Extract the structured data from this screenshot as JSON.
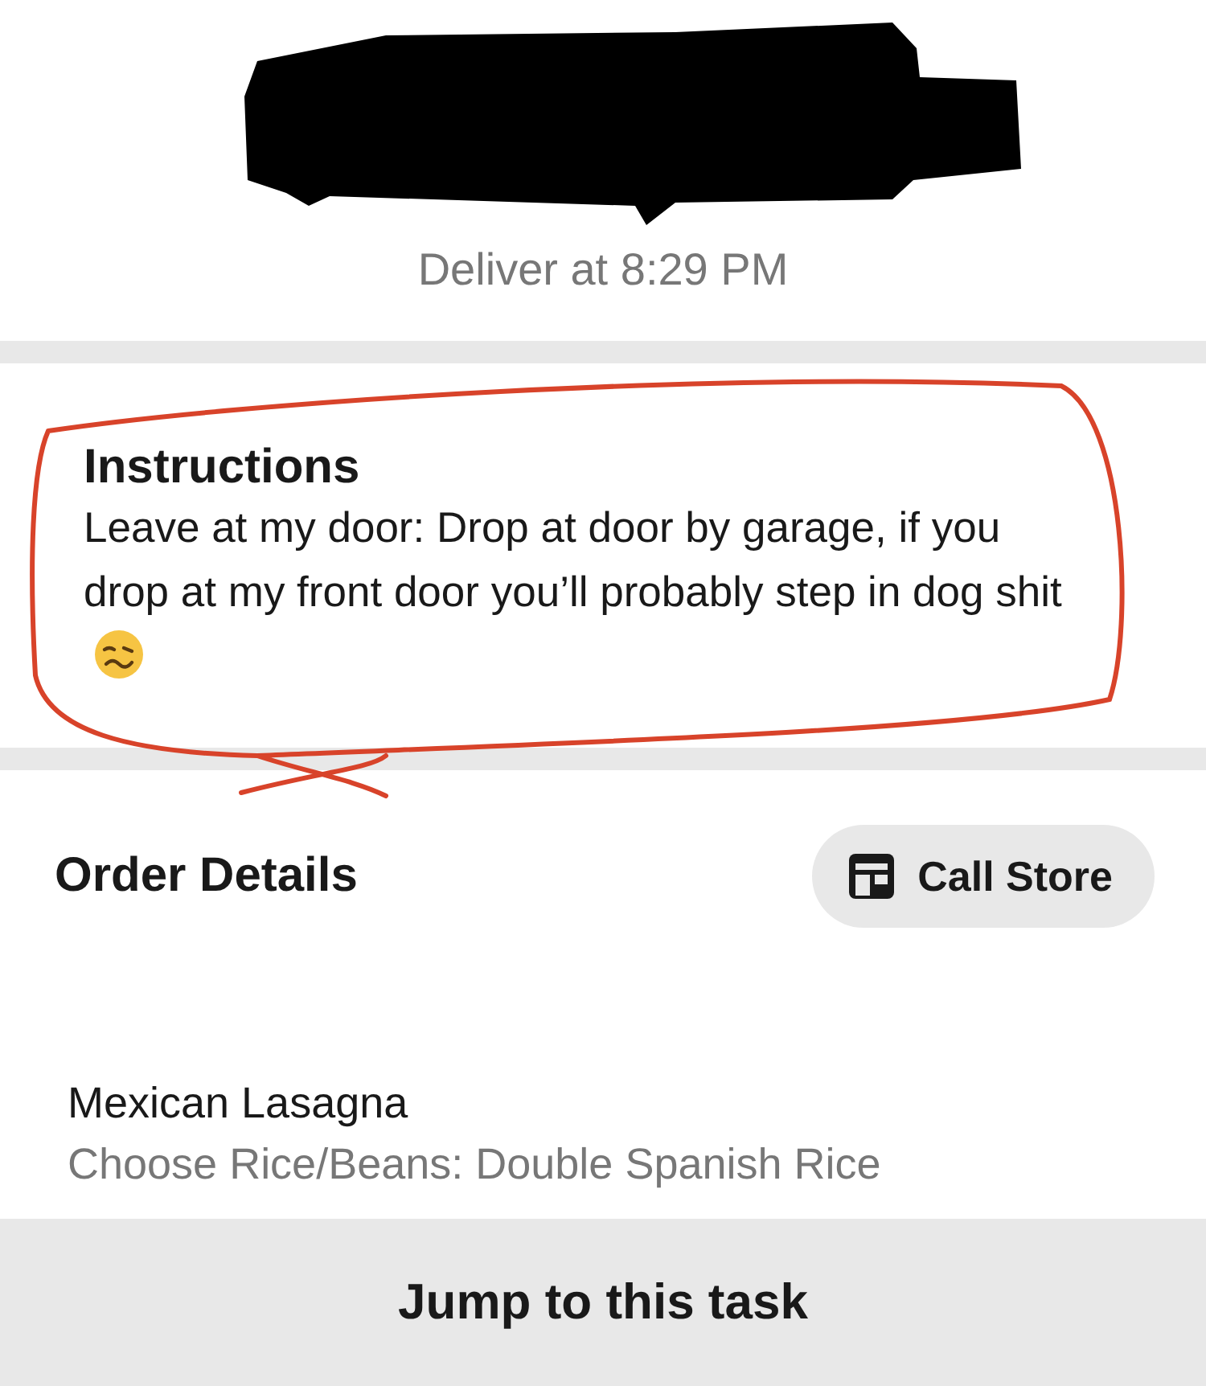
{
  "header": {
    "delivery_time": "Deliver at 8:29 PM"
  },
  "instructions": {
    "title": "Instructions",
    "text": "Leave at my door: Drop at door by garage, if you drop at my front door you’ll probably step in dog shit"
  },
  "order_details": {
    "title": "Order Details",
    "call_button": "Call Store",
    "items": [
      {
        "name": "Mexican Lasagna",
        "option": "Choose Rice/Beans: Double Spanish Rice"
      }
    ]
  },
  "footer_button": "Jump to this task"
}
